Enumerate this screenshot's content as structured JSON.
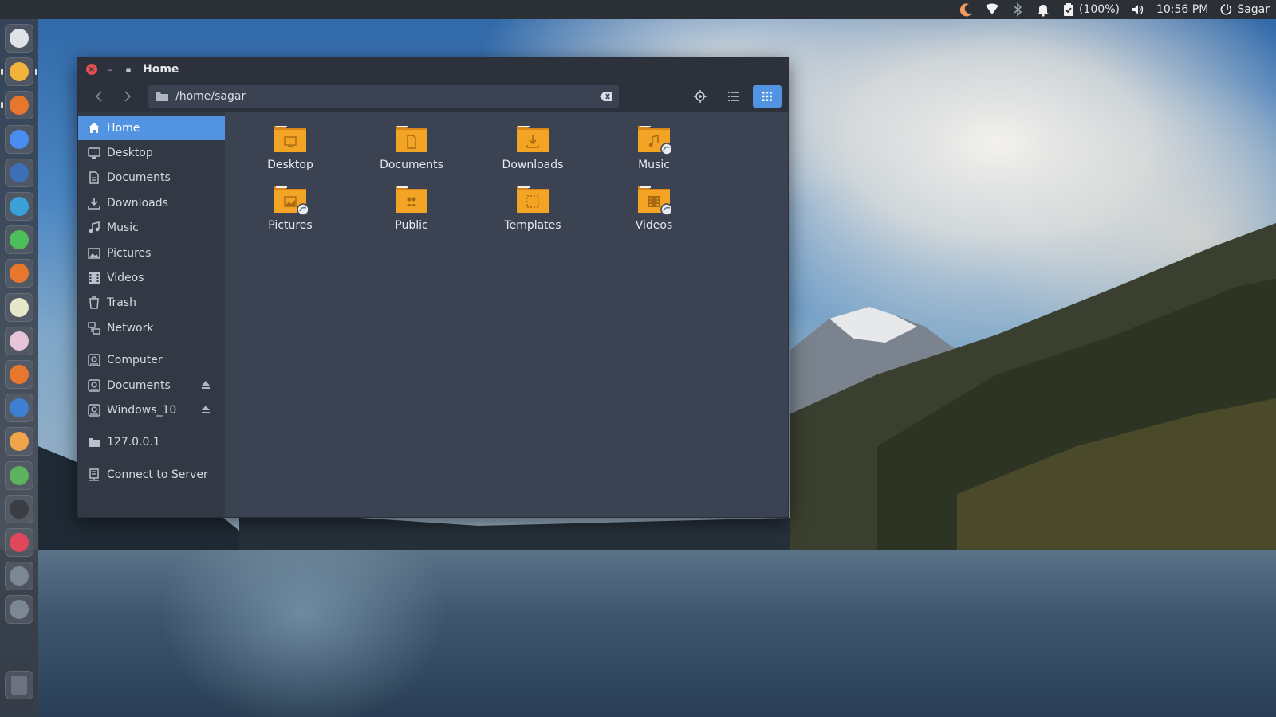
{
  "top_panel": {
    "battery": "(100%)",
    "time": "10:56 PM",
    "user": "Sagar"
  },
  "launcher": {
    "items": [
      {
        "name": "dash-icon",
        "color": "#dfe3e8"
      },
      {
        "name": "files-icon",
        "color": "#f2b33d"
      },
      {
        "name": "firefox-icon",
        "color": "#e8772e"
      },
      {
        "name": "chrome-icon",
        "color": "#4a8cf0"
      },
      {
        "name": "opera-icon",
        "color": "#3d6fb8"
      },
      {
        "name": "writer-icon",
        "color": "#3aa0d8"
      },
      {
        "name": "calc-icon",
        "color": "#4dbf5a"
      },
      {
        "name": "impress-icon",
        "color": "#e8772e"
      },
      {
        "name": "inkscape-icon",
        "color": "#e5e8c9"
      },
      {
        "name": "atom-icon",
        "color": "#e8c4d8"
      },
      {
        "name": "software-center-icon",
        "color": "#e8772e"
      },
      {
        "name": "virtualbox-icon",
        "color": "#3e7fd1"
      },
      {
        "name": "screenshot-icon",
        "color": "#f0a54a"
      },
      {
        "name": "settings-icon",
        "color": "#5bb35e"
      },
      {
        "name": "terminal-icon",
        "color": "#3a3d42"
      },
      {
        "name": "media-icon",
        "color": "#e0475c"
      },
      {
        "name": "disk-icon",
        "color": "#7b8794"
      },
      {
        "name": "disk2-icon",
        "color": "#7b8794"
      },
      {
        "name": "trash-icon",
        "color": "#6b7380"
      }
    ]
  },
  "window": {
    "title": "Home",
    "location": "/home/sagar",
    "accent": "#5294e2",
    "folder_color": "#f4a424"
  },
  "sidebar": {
    "places": [
      {
        "label": "Home",
        "icon": "home-icon",
        "active": true
      },
      {
        "label": "Desktop",
        "icon": "desktop-icon"
      },
      {
        "label": "Documents",
        "icon": "documents-icon"
      },
      {
        "label": "Downloads",
        "icon": "downloads-icon"
      },
      {
        "label": "Music",
        "icon": "music-icon"
      },
      {
        "label": "Pictures",
        "icon": "pictures-icon"
      },
      {
        "label": "Videos",
        "icon": "videos-icon"
      },
      {
        "label": "Trash",
        "icon": "trash-icon"
      },
      {
        "label": "Network",
        "icon": "network-icon"
      }
    ],
    "devices": [
      {
        "label": "Computer",
        "icon": "drive-icon",
        "eject": false
      },
      {
        "label": "Documents",
        "icon": "drive-icon",
        "eject": true
      },
      {
        "label": "Windows_10",
        "icon": "drive-icon",
        "eject": true
      }
    ],
    "network": [
      {
        "label": "127.0.0.1",
        "icon": "folder-icon"
      }
    ],
    "connect": {
      "label": "Connect to Server",
      "icon": "server-icon"
    }
  },
  "files": [
    {
      "label": "Desktop",
      "emblem": "desktop"
    },
    {
      "label": "Documents",
      "emblem": "document"
    },
    {
      "label": "Downloads",
      "emblem": "download"
    },
    {
      "label": "Music",
      "emblem": "music",
      "shared": true
    },
    {
      "label": "Pictures",
      "emblem": "picture",
      "shared": true
    },
    {
      "label": "Public",
      "emblem": "public"
    },
    {
      "label": "Templates",
      "emblem": "template"
    },
    {
      "label": "Videos",
      "emblem": "video",
      "shared": true
    }
  ]
}
